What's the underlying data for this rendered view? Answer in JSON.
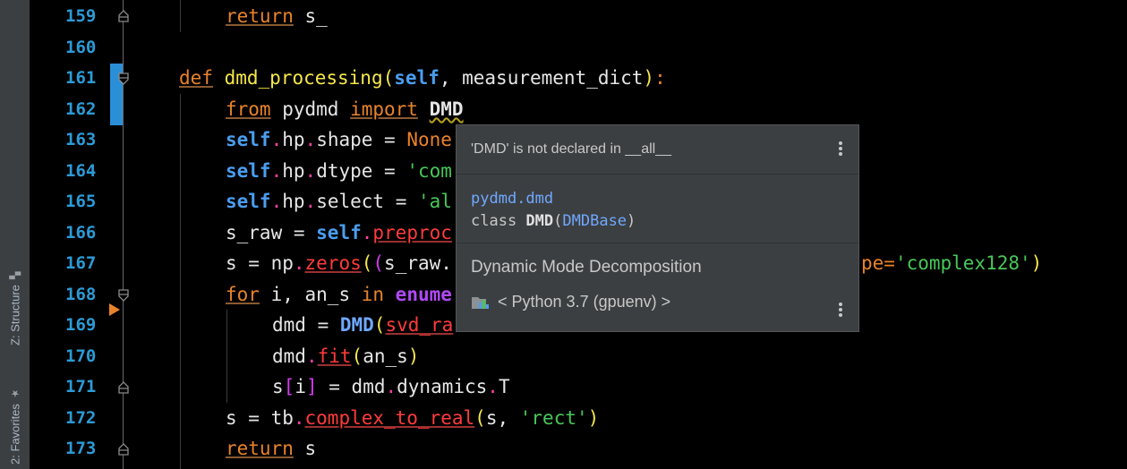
{
  "sidebar": {
    "structure_label": "Z: Structure",
    "favorites_label": "2: Favorites",
    "structure_icon": "structure-icon",
    "favorites_icon": "star-icon"
  },
  "line_numbers": [
    "159",
    "160",
    "161",
    "162",
    "163",
    "164",
    "165",
    "166",
    "167",
    "168",
    "169",
    "170",
    "171",
    "172",
    "173"
  ],
  "code": {
    "l159": {
      "kw": "return",
      "rest": " s_"
    },
    "l161": {
      "def": "def",
      "name": "dmd_processing",
      "open": "(",
      "self": "self",
      "args": ", measurement_dict",
      "close": ")",
      "colon": ":"
    },
    "l162": {
      "from": "from",
      "mod": " pydmd ",
      "imp": "import",
      "cls": "DMD"
    },
    "l163": {
      "self": "self",
      "d1": ".",
      "hp": "hp",
      "d2": ".",
      "attr": "shape = ",
      "val": "None"
    },
    "l164": {
      "self": "self",
      "d1": ".",
      "hp": "hp",
      "d2": ".",
      "attr": "dtype = ",
      "val": "'com"
    },
    "l165": {
      "self": "self",
      "d1": ".",
      "hp": "hp",
      "d2": ".",
      "attr": "select = ",
      "val": "'al"
    },
    "l166": {
      "pre": "s_raw = ",
      "self": "self",
      "d1": ".",
      "fn": "preproc"
    },
    "l167": {
      "pre": "s = np",
      "d1": ".",
      "fn": "zeros",
      "p1": "(",
      "p2": "(",
      "mid": "s_raw.",
      "tail_key": "pe=",
      "tail_str": "'complex128'",
      "tail_close": ")"
    },
    "l168": {
      "for": "for",
      "mid": " i, an_s ",
      "in": "in",
      "bi": " enume"
    },
    "l169": {
      "pre": "dmd = ",
      "cls": "DMD",
      "open": "(",
      "arg": "svd_ra"
    },
    "l170": {
      "pre": "dmd",
      "d1": ".",
      "fn": "fit",
      "open": "(",
      "arg": "an_s",
      "close": ")"
    },
    "l171": {
      "pre": "s",
      "ob": "[",
      "i": "i",
      "cb": "]",
      "mid": " = dmd",
      "d1": ".",
      "dyn": "dynamics",
      "d2": ".",
      "t": "T"
    },
    "l172": {
      "pre": "s = tb",
      "d1": ".",
      "fn": "complex_to_real",
      "open": "(",
      "mid": "s, ",
      "str": "'rect'",
      "close": ")"
    },
    "l173": {
      "kw": "return",
      "rest": " s"
    }
  },
  "popup": {
    "warning": "'DMD' is not declared in __all__",
    "module": "pydmd.dmd",
    "class_kw": "class ",
    "class_name": "DMD",
    "paren_open": "(",
    "base": "DMDBase",
    "paren_close": ")",
    "description": "Dynamic Mode Decomposition",
    "environment": "< Python 3.7 (gpuenv) >",
    "menu_icon": "more-vertical-icon",
    "env_icon": "python-sdk-icon"
  }
}
